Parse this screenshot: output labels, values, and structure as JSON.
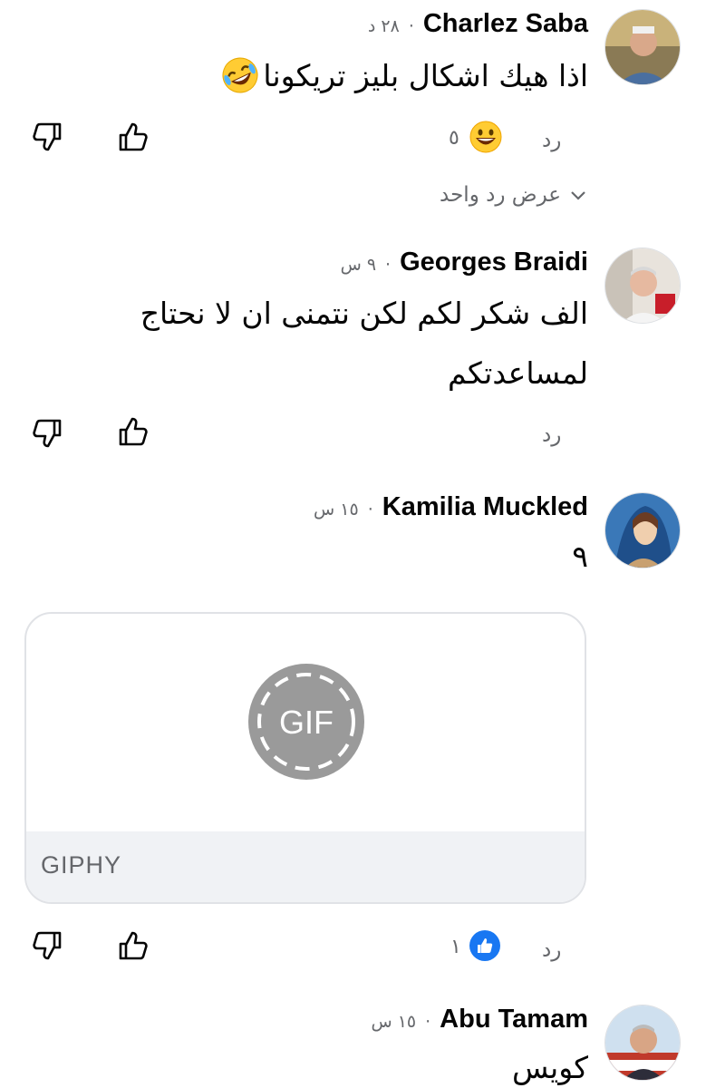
{
  "comments": [
    {
      "author": "Charlez Saba",
      "time": "٢٨ د",
      "separator": "·",
      "text": "اذا هيك اشكال بليز تريكونا",
      "text_emoji": "rolling-on-floor-laughing",
      "reply_label": "رد",
      "reaction_count": "٥",
      "reaction_icon": "grinning-face",
      "view_replies": "عرض رد واحد"
    },
    {
      "author": "Georges Braidi",
      "time": "٩ س",
      "separator": "·",
      "text_line1": "الف شكر لكم لكن نتمنى ان لا نحتاج",
      "text_line2": "لمساعدتكم",
      "reply_label": "رد"
    },
    {
      "author": "Kamilia Muckled",
      "time": "١٥ س",
      "separator": "·",
      "text": "٩",
      "gif_label": "GIF",
      "gif_source": "GIPHY",
      "reply_label": "رد",
      "reaction_count": "١",
      "reaction_icon": "like"
    },
    {
      "author": "Abu Tamam",
      "time": "١٥ س",
      "separator": "·",
      "text": "كويس"
    }
  ],
  "colors": {
    "text_primary": "#050505",
    "text_secondary": "#65676b",
    "like_blue": "#1877f2",
    "gif_gray": "#9a9a9a",
    "footer_bg": "#f0f2f5"
  }
}
